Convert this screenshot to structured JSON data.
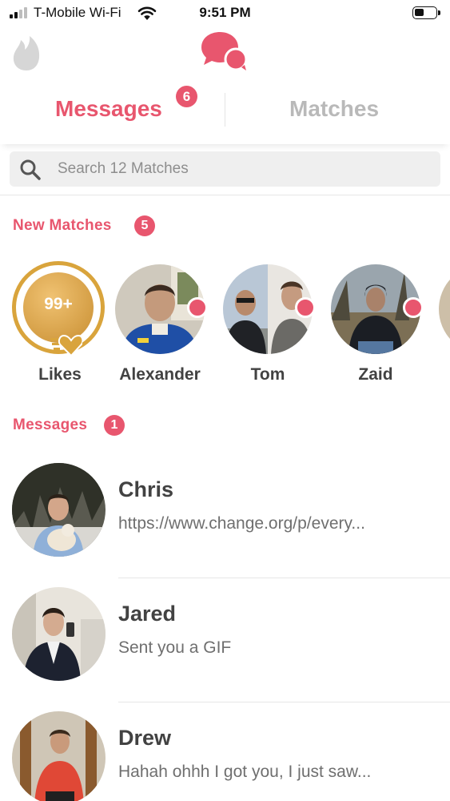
{
  "status_bar": {
    "carrier": "T-Mobile Wi-Fi",
    "time": "9:51 PM",
    "icons": [
      "signal-icon",
      "wifi-icon",
      "battery-icon"
    ]
  },
  "header": {
    "left_icon": "flame-icon",
    "center_icon": "chat-bubbles-icon"
  },
  "tabs": {
    "messages_label": "Messages",
    "messages_badge": "6",
    "matches_label": "Matches",
    "active": "Messages"
  },
  "search": {
    "placeholder": "Search 12 Matches",
    "value": ""
  },
  "new_matches": {
    "title": "New Matches",
    "count": "5",
    "likes_label": "Likes",
    "likes_count": "99+",
    "items": [
      {
        "name": "Alexander",
        "online": true
      },
      {
        "name": "Tom",
        "online": true
      },
      {
        "name": "Zaid",
        "online": true
      }
    ]
  },
  "messages_section": {
    "title": "Messages",
    "count": "1",
    "items": [
      {
        "name": "Chris",
        "preview": "https://www.change.org/p/every..."
      },
      {
        "name": "Jared",
        "preview": "Sent you a GIF"
      },
      {
        "name": "Drew",
        "preview": "Hahah ohhh I got you, I just saw..."
      }
    ]
  },
  "colors": {
    "accent": "#e8566e",
    "inactive_tab": "#b9b9b9",
    "likes_gold": "#d9a43c"
  }
}
